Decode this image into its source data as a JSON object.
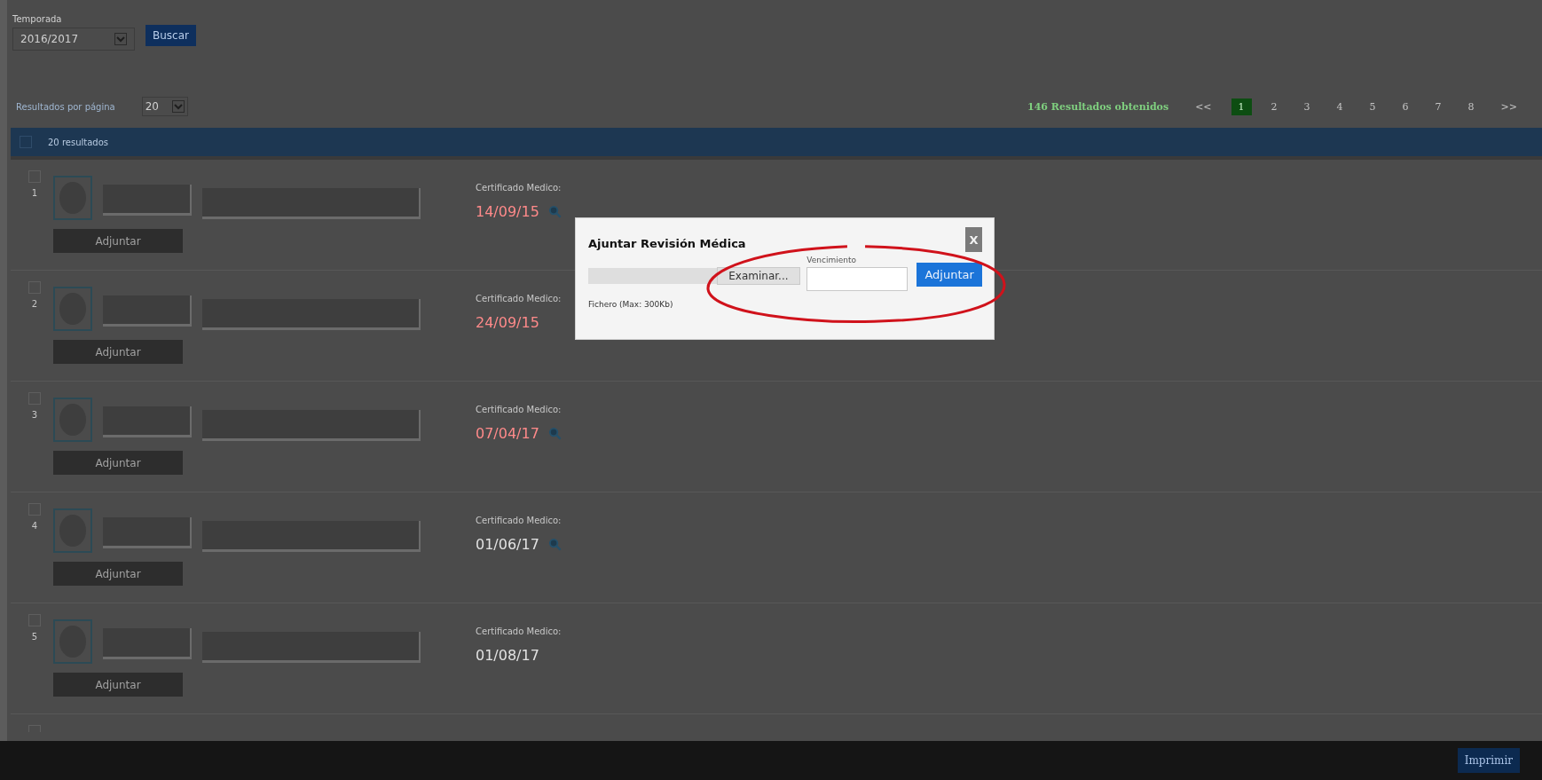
{
  "filter": {
    "label": "Temporada",
    "season": "2016/2017",
    "search_button": "Buscar"
  },
  "results_bar": {
    "per_page_label": "Resultados por página",
    "per_page": "20",
    "total": "146 Resultados obtenidos",
    "prev": "<<",
    "next": ">>",
    "pages": [
      {
        "label": "1",
        "selected": true
      },
      {
        "label": "2",
        "selected": false
      },
      {
        "label": "3",
        "selected": false
      },
      {
        "label": "4",
        "selected": false
      },
      {
        "label": "5",
        "selected": false
      },
      {
        "label": "6",
        "selected": false
      },
      {
        "label": "7",
        "selected": false
      },
      {
        "label": "8",
        "selected": false
      }
    ]
  },
  "list_header": {
    "checked": false,
    "count": "20 resultados"
  },
  "rows": [
    {
      "checked": false,
      "number": "1",
      "cert_label": "Certificado Medico:",
      "date": "14/09/15",
      "expired": true,
      "has_file": true,
      "attach_button": "Adjuntar"
    },
    {
      "checked": false,
      "number": "2",
      "cert_label": "Certificado Medico:",
      "date": "24/09/15",
      "expired": true,
      "has_file": false,
      "attach_button": "Adjuntar"
    },
    {
      "checked": false,
      "number": "3",
      "cert_label": "Certificado Medico:",
      "date": "07/04/17",
      "expired": true,
      "has_file": true,
      "attach_button": "Adjuntar"
    },
    {
      "checked": false,
      "number": "4",
      "cert_label": "Certificado Medico:",
      "date": "01/06/17",
      "expired": false,
      "has_file": true,
      "attach_button": "Adjuntar"
    },
    {
      "checked": false,
      "number": "5",
      "cert_label": "Certificado Medico:",
      "date": "01/08/17",
      "expired": false,
      "has_file": false,
      "attach_button": "Adjuntar"
    },
    {
      "checked": false
    }
  ],
  "footer": {
    "print_button": "Imprimir"
  },
  "modal": {
    "title": "Ajuntar Revisión Médica",
    "close": "X",
    "browse_button": "Examinar...",
    "due_label": "Vencimiento",
    "attach_button": "Adjuntar",
    "file_hint": "Fichero (Max: 300Kb)"
  }
}
